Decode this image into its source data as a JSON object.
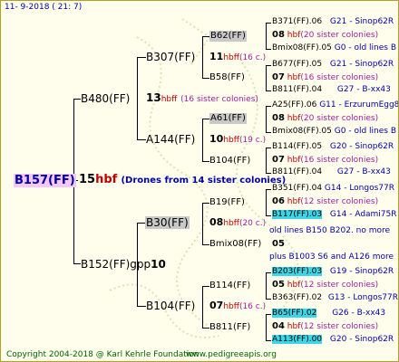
{
  "header": {
    "date": "11-  9-2018 ( 21:  7)"
  },
  "root": {
    "name": "B157(FF)",
    "gen_num": "15",
    "hbf": "hbf",
    "note": "(Drones from 14 sister colonies)"
  },
  "sire": {
    "name": "B480(FF)",
    "gen_num": "13",
    "hbf": "hbff",
    "note": "(16 sister colonies)"
  },
  "dam": {
    "name": "B152(FF)gpp",
    "gen_num": "10"
  },
  "nodes": {
    "b307": "B307(FF)",
    "b62": "B62(FF)",
    "b58": "B58(FF)",
    "a144": "A144(FF)",
    "a61": "A61(FF)",
    "b104a": "B104(FF)",
    "b30": "B30(FF)",
    "b19": "B19(FF)",
    "bmix08": "Bmix08(FF)",
    "b104b": "B104(FF)",
    "b114": "B114(FF)",
    "b811": "B811(FF)"
  },
  "mid_labels": {
    "b307": {
      "num": "11",
      "hbf": "hbff",
      "note": "(16 c.)"
    },
    "a144": {
      "num": "10",
      "hbf": "hbff",
      "note": "(19 c.)"
    },
    "b30": {
      "num": "08",
      "hbf": "hbff",
      "note": "(20 c.)"
    },
    "b104b": {
      "num": "07",
      "hbf": "hbff",
      "note": "(16 c.)"
    }
  },
  "right": [
    {
      "a": "B371(FF).06",
      "b": "G21 - Sinop62R"
    },
    {
      "num": "08",
      "hbf": "hbf",
      "note": "(20 sister colonies)"
    },
    {
      "a": "Bmix08(FF).05",
      "b": "G0 - old lines B"
    },
    {
      "a": "B677(FF).05",
      "b": "G21 - Sinop62R"
    },
    {
      "num": "07",
      "hbf": "hbf",
      "note": "(16 sister colonies)"
    },
    {
      "a": "B811(FF).04",
      "b": "G27 - B-xx43"
    },
    {
      "a": "A25(FF).06",
      "b": "G11 - ErzurumEgg8"
    },
    {
      "num": "08",
      "hbf": "hbf",
      "note": "(20 sister colonies)"
    },
    {
      "a": "Bmix08(FF).05",
      "b": "G0 - old lines B"
    },
    {
      "a": "B114(FF).05",
      "b": "G20 - Sinop62R"
    },
    {
      "num": "07",
      "hbf": "hbf",
      "note": "(16 sister colonies)"
    },
    {
      "a": "B811(FF).04",
      "b": "G27 - B-xx43"
    },
    {
      "a": "B351(FF).04",
      "b": "G14 - Longos77R"
    },
    {
      "num": "06",
      "hbf": "hbf",
      "note": "(12 sister colonies)"
    },
    {
      "a": "B117(FF).03",
      "b": "G14 - Adami75R"
    },
    {
      "text": "old lines B150 B202.  no more"
    },
    {
      "num": "05",
      "hbf": "",
      "note": ""
    },
    {
      "text": "plus B1003 S6 and A126",
      "more": "more"
    },
    {
      "a": "B203(FF).03",
      "b": "G19 - Sinop62R"
    },
    {
      "num": "05",
      "hbf": "hbf",
      "note": "(12 sister colonies)"
    },
    {
      "a": "B363(FF).02",
      "b": "G13 - Longos77R"
    },
    {
      "a": "B65(FF).02",
      "b": "G26 - B-xx43"
    },
    {
      "num": "04",
      "hbf": "hbf",
      "note": "(12 sister colonies)"
    },
    {
      "a": "A113(FF).00",
      "b": "G20 - Sinop62R"
    }
  ],
  "footer": {
    "copyright": "Copyright 2004-2018 @ Karl Kehrle Foundation",
    "site": "www.pedigreeapis.org"
  }
}
